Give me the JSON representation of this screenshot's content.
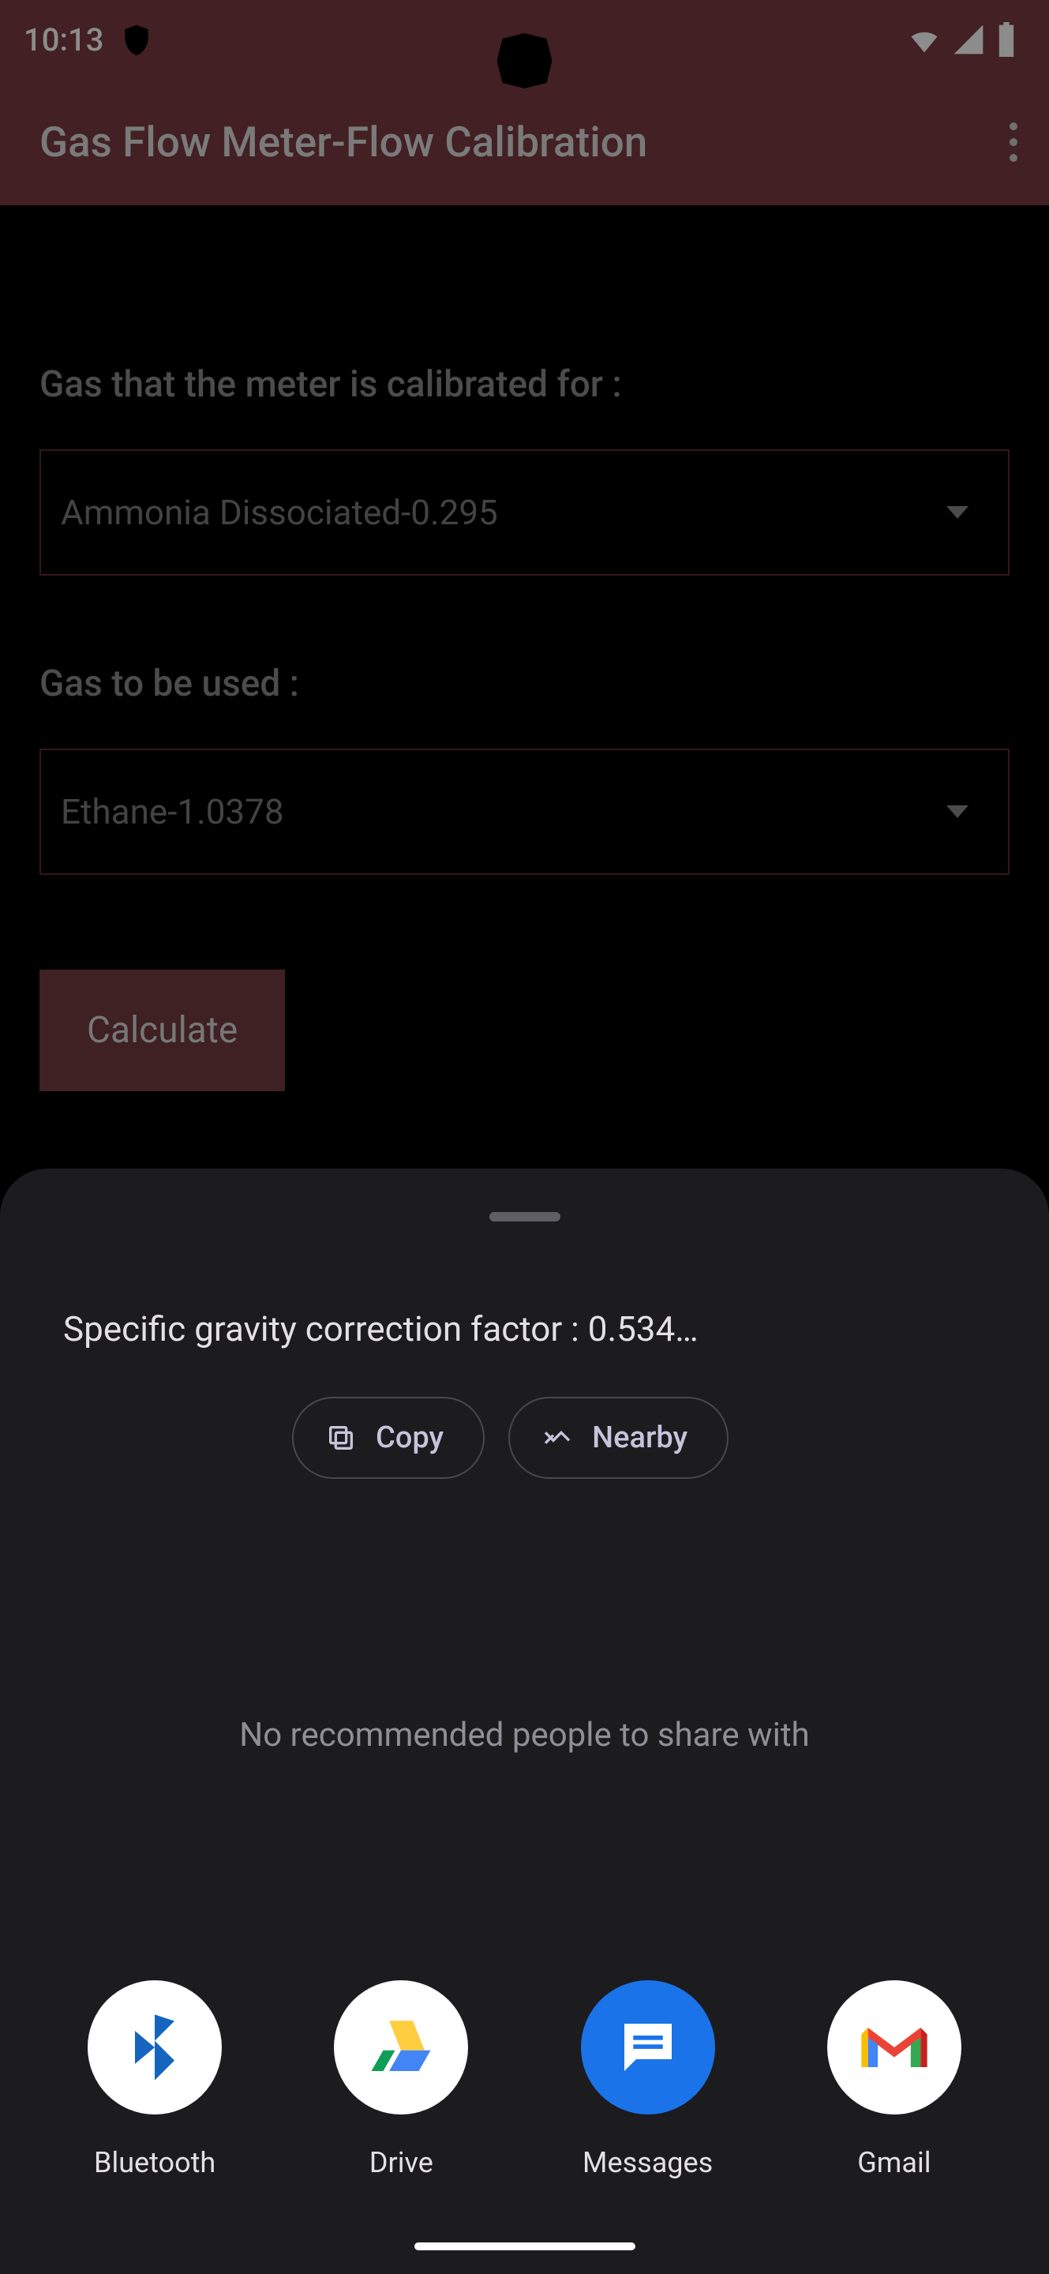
{
  "status": {
    "time": "10:13",
    "icons": [
      "shield",
      "wifi",
      "signal",
      "battery"
    ]
  },
  "app_bar": {
    "title": "Gas Flow Meter-Flow Calibration"
  },
  "form": {
    "label1": "Gas that the meter is calibrated for :",
    "select1": "Ammonia Dissociated-0.295",
    "label2": "Gas to be used :",
    "select2": "Ethane-1.0378",
    "calc_label": "Calculate"
  },
  "sheet": {
    "share_text": "Specific gravity correction factor : 0.534…",
    "copy_label": "Copy",
    "nearby_label": "Nearby",
    "no_recs": "No recommended people to share with",
    "apps": [
      {
        "label": "Bluetooth"
      },
      {
        "label": "Drive"
      },
      {
        "label": "Messages"
      },
      {
        "label": "Gmail"
      }
    ]
  }
}
